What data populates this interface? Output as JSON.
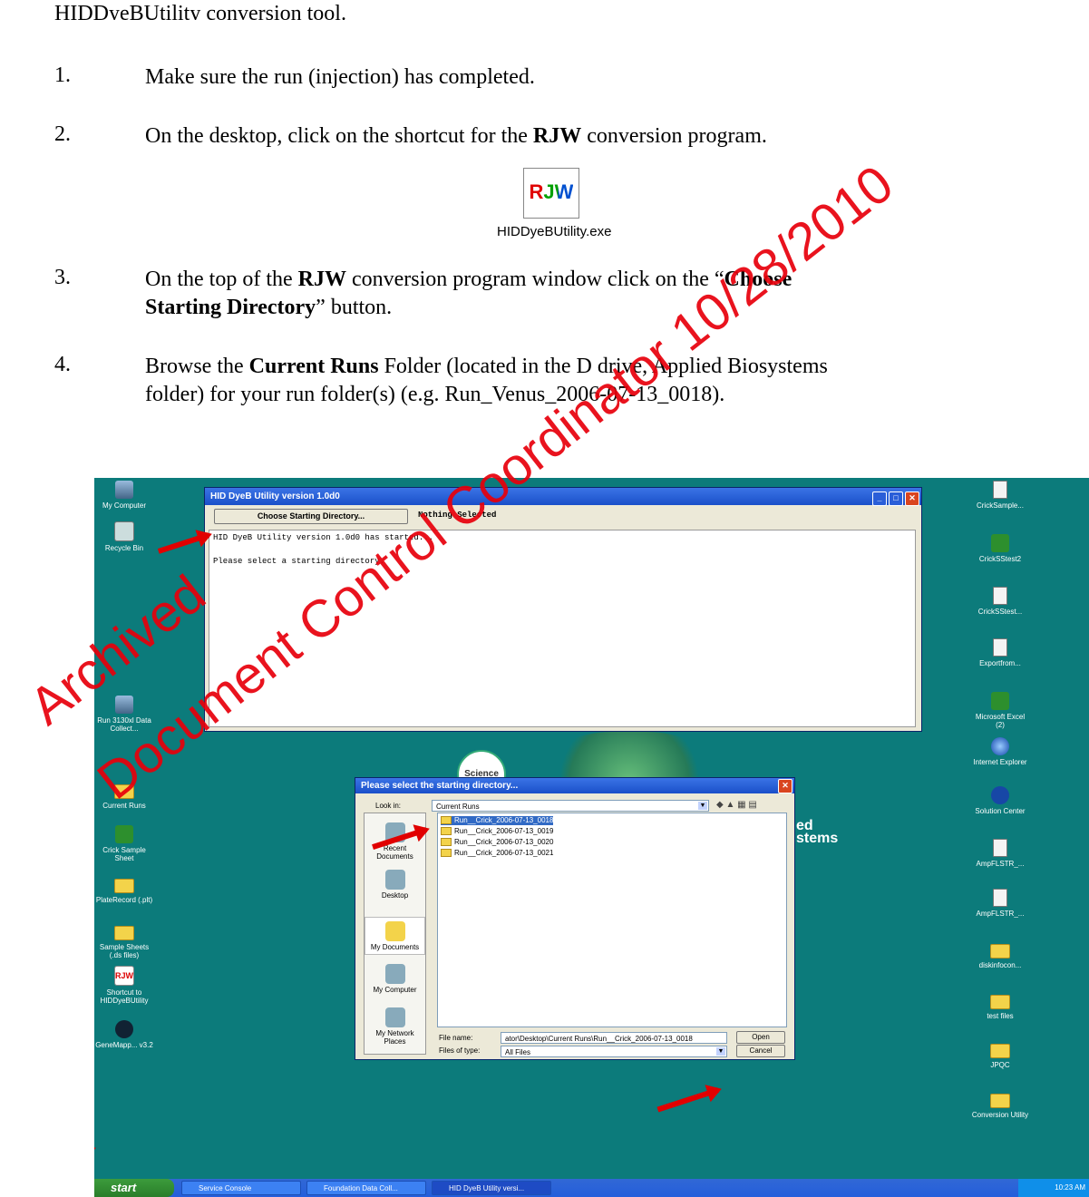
{
  "document": {
    "intro_line": "HIDDyeBUtility conversion tool.",
    "steps": [
      {
        "num": "1.",
        "text": "Make sure the run (injection) has completed."
      },
      {
        "num": "2.",
        "pre": "On the desktop, click on the shortcut for the ",
        "bold": "RJW",
        "post": " conversion program."
      },
      {
        "num": "3.",
        "pre": "On the top of the ",
        "bold": "RJW",
        "mid": " conversion program window click on the “",
        "bold2": "Choose",
        "line2_bold": "Starting Directory",
        "line2_post": "” button."
      },
      {
        "num": "4.",
        "pre": "Browse the ",
        "bold": "Current Runs",
        "post": " Folder (located in the D drive, Applied Biosystems",
        "line2": "folder) for your run folder(s) (e.g.  Run_Venus_2006-07-13_0018)."
      }
    ],
    "shortcut_icon_text": "RJW",
    "shortcut_caption": "HIDDyeBUtility.exe"
  },
  "watermark": {
    "line1": "Archived",
    "line2": "Document Control Coordinator 10/28/2010",
    "color": "#e8000b"
  },
  "screenshot": {
    "left_icons": [
      "My Computer",
      "Recycle Bin",
      "Run 3130xl Data Collect...",
      "Current Runs",
      "Crick Sample Sheet",
      "PlateRecord (.plt)",
      "Sample Sheets (.ds files)",
      "Shortcut to HIDDyeBUtility",
      "GeneMapp... v3.2"
    ],
    "right_icons": [
      "CrickSample...",
      "CrickSStest2",
      "CrickSStest...",
      "Exportfrom...",
      "Microsoft Excel (2)",
      "Internet Explorer",
      "Solution Center",
      "AmpFLSTR_...",
      "AmpFLSTR_...",
      "diskinfocon...",
      "test files",
      "JPQC",
      "Conversion Utility"
    ],
    "main_window": {
      "title": "HID DyeB Utility version 1.0d0",
      "choose_button": "Choose Starting Directory...",
      "status": "Nothing Selected",
      "log_line1": "HID DyeB Utility version 1.0d0 has started...",
      "log_line2": "Please select a starting directory."
    },
    "background_logo": {
      "science": "Science",
      "brand_line1": "ed",
      "brand_line2": "stems"
    },
    "dialog": {
      "title": "Please select the starting directory...",
      "look_in_label": "Look in:",
      "look_in_value": "Current Runs",
      "places": [
        "Recent Documents",
        "Desktop",
        "My Documents",
        "My Computer",
        "My Network Places"
      ],
      "files": [
        "Run__Crick_2006-07-13_0018",
        "Run__Crick_2006-07-13_0019",
        "Run__Crick_2006-07-13_0020",
        "Run__Crick_2006-07-13_0021"
      ],
      "file_name_label": "File name:",
      "file_name_value": "ator\\Desktop\\Current Runs\\Run__Crick_2006-07-13_0018",
      "files_of_type_label": "Files of type:",
      "files_of_type_value": "All Files",
      "open_button": "Open",
      "cancel_button": "Cancel"
    },
    "taskbar": {
      "start": "start",
      "tasks": [
        "Service Console",
        "Foundation Data Coll...",
        "HID DyeB Utility versi..."
      ],
      "clock": "10:23 AM"
    }
  }
}
